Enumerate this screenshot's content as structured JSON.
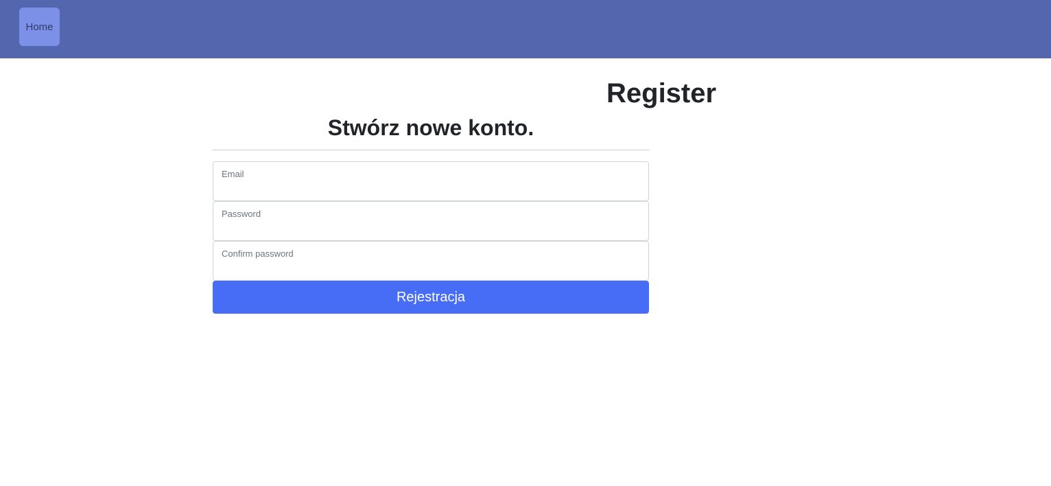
{
  "nav": {
    "home_label": "Home"
  },
  "page": {
    "title": "Register"
  },
  "form": {
    "heading": "Stwórz nowe konto.",
    "fields": [
      {
        "label": "Email",
        "value": ""
      },
      {
        "label": "Password",
        "value": ""
      },
      {
        "label": "Confirm password",
        "value": ""
      }
    ],
    "submit_label": "Rejestracja"
  },
  "colors": {
    "navbar": "#5366ae",
    "nav_home_bg": "#7d90e8",
    "primary_button": "#476cf5"
  }
}
